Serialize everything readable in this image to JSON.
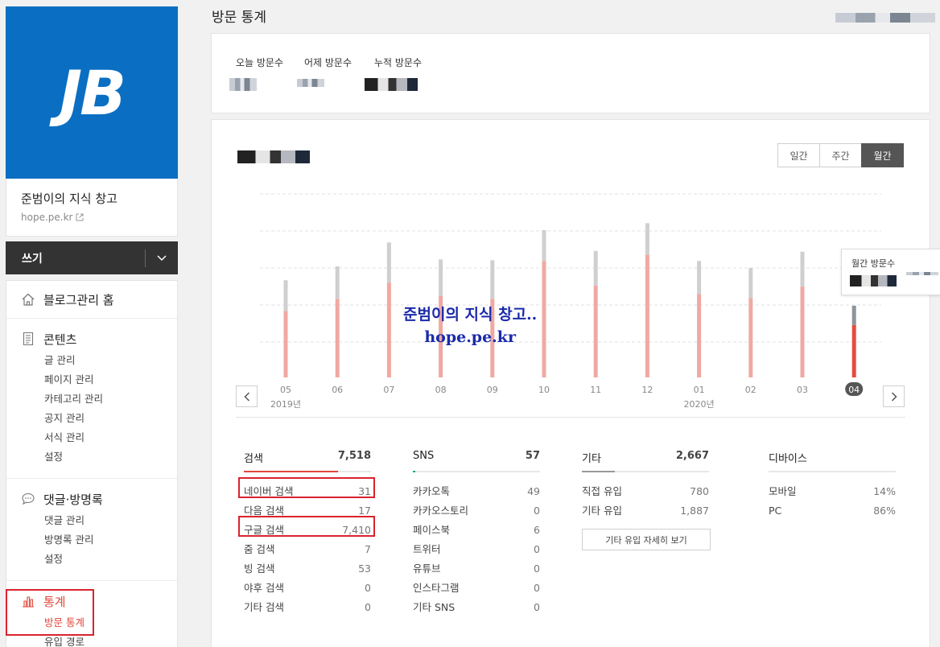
{
  "sidebar": {
    "logo_text": "JB",
    "blog_name": "준범이의 지식 창고",
    "blog_url": "hope.pe.kr",
    "write_label": "쓰기",
    "home_label": "블로그관리 홈",
    "groups": [
      {
        "title": "콘텐츠",
        "items": [
          "글 관리",
          "페이지 관리",
          "카테고리 관리",
          "공지 관리",
          "서식 관리",
          "설정"
        ]
      },
      {
        "title": "댓글·방명록",
        "items": [
          "댓글 관리",
          "방명록 관리",
          "설정"
        ]
      },
      {
        "title": "통계",
        "items": [
          "방문 통계",
          "유입 경로"
        ]
      }
    ]
  },
  "header": {
    "title": "방문 통계"
  },
  "summary": {
    "today_label": "오늘 방문수",
    "yesterday_label": "어제 방문수",
    "total_label": "누적 방문수"
  },
  "period_tabs": [
    "일간",
    "주간",
    "월간"
  ],
  "active_period": "월간",
  "tooltip_label": "월간 방문수",
  "watermark": {
    "line1": "준범이의 지식 창고..",
    "line2": "hope.pe.kr"
  },
  "chart_data": {
    "type": "bar",
    "categories": [
      "05",
      "06",
      "07",
      "08",
      "09",
      "10",
      "11",
      "12",
      "01",
      "02",
      "03",
      "04"
    ],
    "year_labels": [
      {
        "at": "05",
        "label": "2019년"
      },
      {
        "at": "01",
        "label": "2020년"
      }
    ],
    "selected": "04",
    "series": [
      {
        "values": [
          86,
          102,
          123,
          106,
          102,
          151,
          119,
          159,
          108,
          103,
          118,
          68
        ],
        "color": "#f0a9a2"
      },
      {
        "values": [
          40,
          42,
          52,
          47,
          50,
          40,
          45,
          41,
          43,
          39,
          45,
          25
        ],
        "color": "#cfcfcf"
      }
    ],
    "ylim": [
      0,
      240
    ],
    "grid": true
  },
  "colors": {
    "accent": "#e0473a",
    "brand": "#0a6fc2",
    "sns": "#1aa67a"
  },
  "stats": {
    "search": {
      "title": "검색",
      "total": "7,518",
      "rows": [
        [
          "네이버 검색",
          "31"
        ],
        [
          "다음 검색",
          "17"
        ],
        [
          "구글 검색",
          "7,410"
        ],
        [
          "줌 검색",
          "7"
        ],
        [
          "빙 검색",
          "53"
        ],
        [
          "야후 검색",
          "0"
        ],
        [
          "기타 검색",
          "0"
        ]
      ]
    },
    "sns": {
      "title": "SNS",
      "total": "57",
      "rows": [
        [
          "카카오톡",
          "49"
        ],
        [
          "카카오스토리",
          "0"
        ],
        [
          "페이스북",
          "6"
        ],
        [
          "트위터",
          "0"
        ],
        [
          "유튜브",
          "0"
        ],
        [
          "인스타그램",
          "0"
        ],
        [
          "기타 SNS",
          "0"
        ]
      ]
    },
    "etc": {
      "title": "기타",
      "total": "2,667",
      "rows": [
        [
          "직접 유입",
          "780"
        ],
        [
          "기타 유입",
          "1,887"
        ]
      ],
      "button": "기타 유입 자세히 보기"
    },
    "device": {
      "title": "디바이스",
      "rows": [
        [
          "모바일",
          "14%"
        ],
        [
          "PC",
          "86%"
        ]
      ]
    }
  }
}
